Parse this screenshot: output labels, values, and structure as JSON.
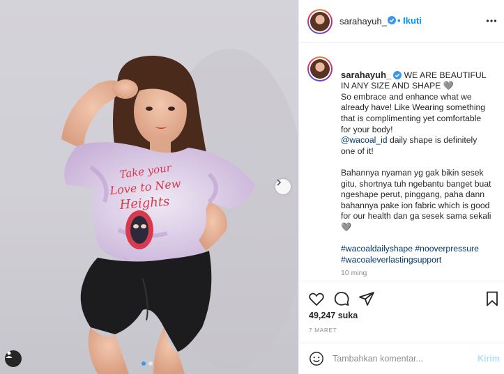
{
  "post": {
    "username": "sarahayuh_",
    "follow_label": "• Ikuti",
    "caption": {
      "headline": "WE ARE BEAUTIFUL IN ANY SIZE AND SHAPE 🩶",
      "line1": "So embrace and enhance what we already have! Like Wearing something that is complimenting yet comfortable for your body!",
      "mention": "@wacoal_id",
      "line2": " daily shape is definitely one of it!",
      "para2": "Bahannya nyaman yg gak bikin sesek gitu, shortnya tuh ngebantu banget buat ngeshape perut, pinggang, paha dann bahannya pake ion fabric which is good for our health dan ga sesek sama sekali 🩶",
      "hashtag1": "#wacoaldailyshape",
      "hashtag2": "#nooverpressure",
      "hashtag3": "#wacoaleverlastingsupport"
    },
    "time_ago": "10 ming",
    "likes": "49,247 suka",
    "date": "7 MARET",
    "comment_placeholder": "Tambahkan komentar...",
    "send_label": "Kirim",
    "carousel": {
      "count": 2,
      "active_index": 0
    }
  },
  "icons": {
    "verified": "verified-badge-icon",
    "more": "more-options-icon",
    "like": "heart-icon",
    "comment": "comment-icon",
    "share": "paper-plane-icon",
    "save": "bookmark-icon",
    "emoji": "smiley-icon",
    "next": "chevron-right-icon",
    "user_tag": "user-tag-icon"
  },
  "colors": {
    "accent": "#0095f6",
    "verified": "#3897f0",
    "link": "#00376b",
    "muted": "#8e8e8e"
  }
}
